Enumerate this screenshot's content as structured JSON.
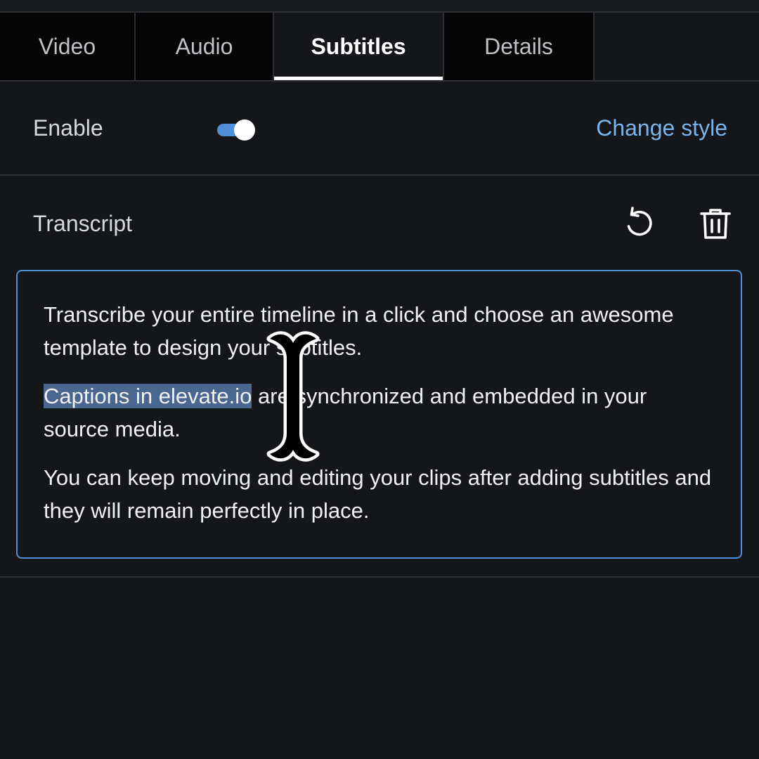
{
  "tabs": [
    {
      "label": "Video",
      "active": false
    },
    {
      "label": "Audio",
      "active": false
    },
    {
      "label": "Subtitles",
      "active": true
    },
    {
      "label": "Details",
      "active": false
    }
  ],
  "subtitles": {
    "enable_label": "Enable",
    "enabled": true,
    "change_style_label": "Change style"
  },
  "transcript": {
    "title": "Transcript",
    "paragraphs": [
      {
        "text": "Transcribe your entire timeline in a click and choose an awesome template to design your subtitles."
      },
      {
        "selected": "Captions in elevate.io",
        "rest": " are synchronized and embedded in your source media."
      },
      {
        "text": "You can keep moving and editing your clips after adding subtitles and they will remain perfectly in place."
      }
    ]
  },
  "icons": {
    "undo": "undo-icon",
    "trash": "trash-icon",
    "cursor": "text-cursor-icon"
  },
  "colors": {
    "accent": "#4f8fd8",
    "link": "#79b4ec",
    "selection": "#4a678f",
    "background": "#151619",
    "tab_inactive_bg": "#050506"
  }
}
